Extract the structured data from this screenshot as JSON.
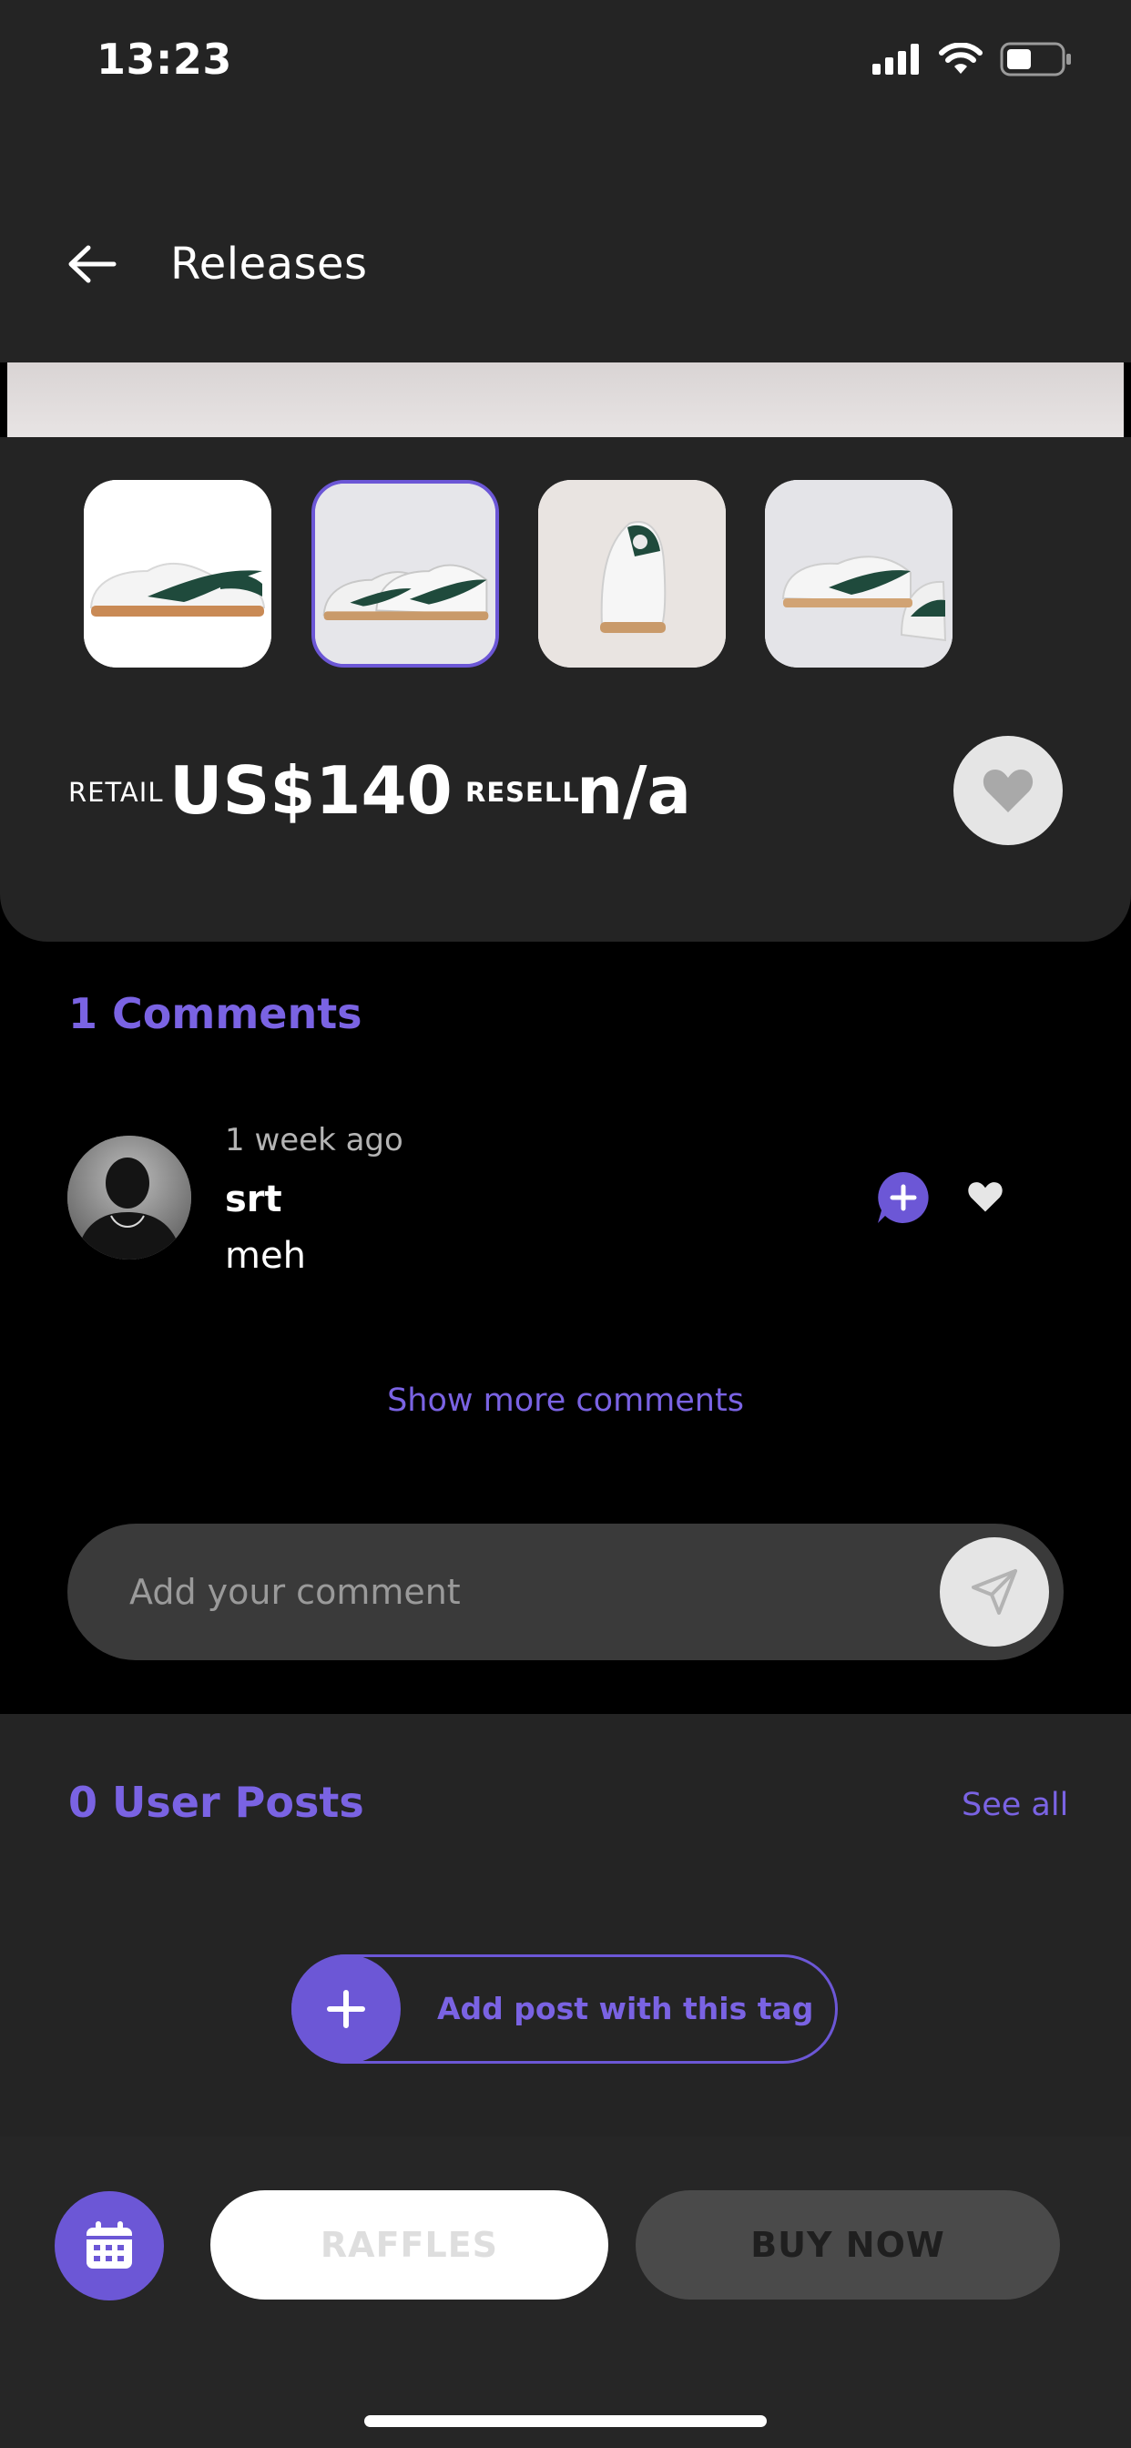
{
  "status_bar": {
    "time": "13:23"
  },
  "header": {
    "title": "Releases"
  },
  "product": {
    "thumbnails": [
      {
        "name": "thumb-1",
        "selected": false
      },
      {
        "name": "thumb-2",
        "selected": true
      },
      {
        "name": "thumb-3",
        "selected": false
      },
      {
        "name": "thumb-4",
        "selected": false
      }
    ],
    "retail_label": "RETAIL",
    "retail_value": "US$140",
    "resell_label": "RESELL",
    "resell_value": "n/a"
  },
  "comments": {
    "title": "1 Comments",
    "items": [
      {
        "time": "1 week ago",
        "user": "srt",
        "text": "meh"
      }
    ],
    "show_more": "Show more comments",
    "input_placeholder": "Add your comment"
  },
  "user_posts": {
    "title": "0 User Posts",
    "see_all": "See all",
    "add_post": "Add post with this tag"
  },
  "bottom_bar": {
    "raffles": "RAFFLES",
    "buy_now": "BUY NOW"
  },
  "colors": {
    "accent": "#6c57d6",
    "panel": "#242424",
    "background": "#000000"
  }
}
